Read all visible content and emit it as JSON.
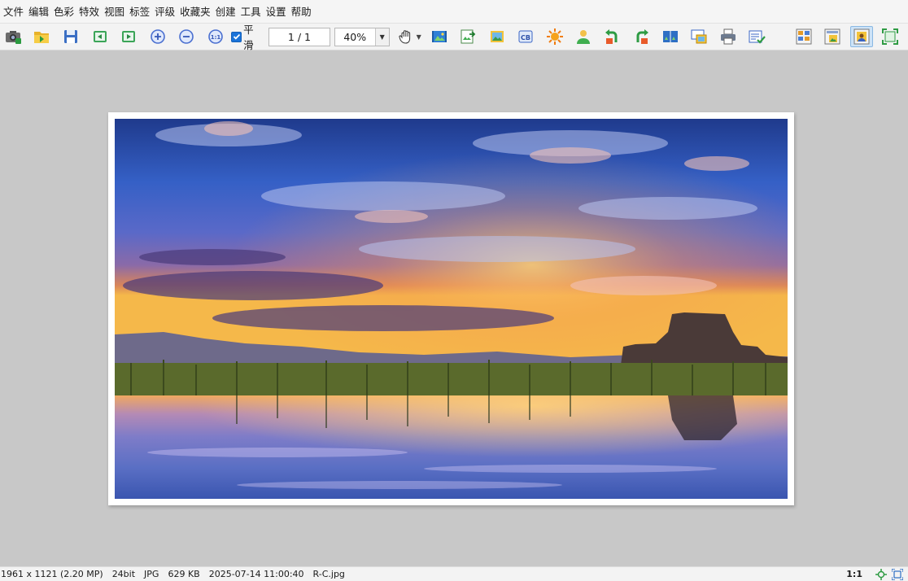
{
  "menu": [
    "文件",
    "编辑",
    "色彩",
    "特效",
    "视图",
    "标签",
    "评级",
    "收藏夹",
    "创建",
    "工具",
    "设置",
    "帮助"
  ],
  "toolbar": {
    "smooth_label": "平滑",
    "smooth_checked": true,
    "page_indicator": "1 / 1",
    "zoom_value": "40%"
  },
  "status": {
    "dimensions": "1961 x 1121 (2.20 MP)",
    "bit_depth": "24bit",
    "format": "JPG",
    "file_size": "629 KB",
    "date": "2025-07-14 11:00:40",
    "filename": "R-C.jpg",
    "ratio": "1:1"
  },
  "colors": {
    "accent": "#1a73d9",
    "canvas_bg": "#c8c8c8",
    "toolbar_bg": "#f3f3f3"
  }
}
